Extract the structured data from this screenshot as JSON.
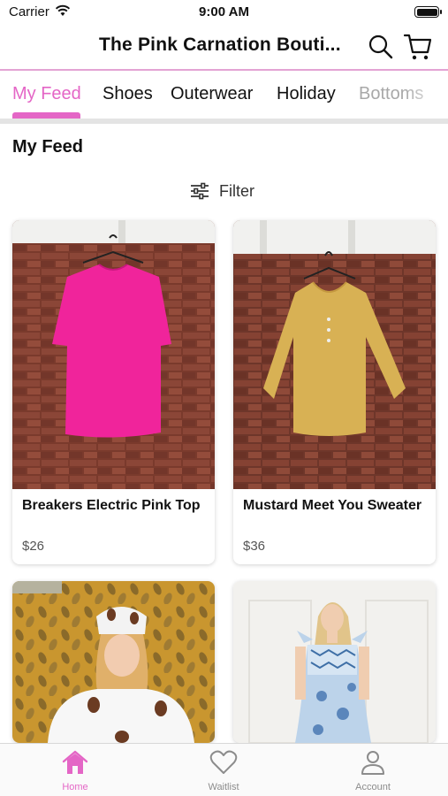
{
  "status_bar": {
    "carrier": "Carrier",
    "time": "9:00 AM"
  },
  "header": {
    "title": "The Pink Carnation Bouti..."
  },
  "tabs": [
    {
      "label": "My Feed",
      "active": true
    },
    {
      "label": "Shoes"
    },
    {
      "label": "Outerwear"
    },
    {
      "label": "Holiday"
    },
    {
      "label": "Bottoms"
    }
  ],
  "section": {
    "title": "My Feed",
    "filter_label": "Filter"
  },
  "products": [
    {
      "name": "Breakers Electric Pink Top",
      "price": "$26",
      "color": "#f0249b"
    },
    {
      "name": "Mustard Meet You Sweater",
      "price": "$36",
      "color": "#d8b154"
    }
  ],
  "bottom_tabs": [
    {
      "label": "Home",
      "icon": "home-icon",
      "active": true
    },
    {
      "label": "Waitlist",
      "icon": "heart-icon"
    },
    {
      "label": "Account",
      "icon": "person-icon"
    }
  ],
  "colors": {
    "accent": "#e466c6",
    "accent_light": "#e3a3d4"
  }
}
